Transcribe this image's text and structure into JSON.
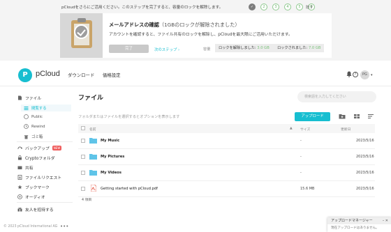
{
  "banner": {
    "message": "pCloudをさらにご活用ください。このステップを完了すると、容量のロックを解除します。",
    "steps": [
      "1",
      "2",
      "3",
      "4",
      "5",
      "6"
    ],
    "skip_label": "隠す",
    "card": {
      "title": "メールアドレスの確認",
      "title_suffix": "（1GBのロックが解除されました）",
      "description": "アカウントを確認すると、ファイル共有のロックを解除し、pCloudを最大限にご活用いただけます。",
      "done_button": "完了",
      "next_step": "次のステップ ›",
      "bonus_label": "容量",
      "unlocked_label": "ロックを解除しました:",
      "unlocked_value": "3.0 GB",
      "total_label": "ロックされました:",
      "total_value": "7.0 GB"
    }
  },
  "header": {
    "logo_text": "pCloud",
    "logo_letter": "P",
    "nav_download": "ダウンロード",
    "nav_pricing": "価格設定",
    "help_glyph": "?",
    "avatar_initials": "PG",
    "caret": "▾"
  },
  "sidebar": {
    "files": "ファイル",
    "sub_items": [
      "閲覧する",
      "Public",
      "Rewind",
      "ゴミ箱"
    ],
    "items": [
      {
        "label": "バックアップ",
        "badge": "NEW"
      },
      {
        "label": "Cryptoフォルダ"
      },
      {
        "label": "共有"
      },
      {
        "label": "ファイルリクエスト"
      },
      {
        "label": "ブックマーク"
      },
      {
        "label": "オーディオ"
      }
    ],
    "invite": "友人を招待する",
    "copyright": "© 2023 pCloud International AG",
    "more": "•••"
  },
  "main": {
    "title": "ファイル",
    "search_placeholder": "検索語を入力してください",
    "hint": "フォルダまたはファイルを選択するとオプションを表示します",
    "upload_button": "アップロード",
    "columns": {
      "name": "名前",
      "name_sort": "▲",
      "size": "サイズ",
      "modified": "更新日"
    },
    "rows": [
      {
        "name": "My Music",
        "size": "-",
        "date": "2023/5/16"
      },
      {
        "name": "My Pictures",
        "size": "-",
        "date": "2023/5/16"
      },
      {
        "name": "My Videos",
        "size": "-",
        "date": "2023/5/16"
      },
      {
        "name": "Getting started with pCloud.pdf",
        "size": "15.6 MB",
        "date": "2023/5/16"
      }
    ],
    "count": "4 項目"
  },
  "upload_manager": {
    "title": "アップロードマネージャー",
    "controls": "– ✕",
    "body": "現在アップロードはありません。"
  },
  "colors": {
    "accent": "#17bed0",
    "folder": "#5fc4e8",
    "pdf": "#e2412c",
    "step_green": "#6bb56b",
    "new_badge": "#ef5a5a"
  },
  "icons": [
    "file-icon",
    "browse-icon",
    "public-icon",
    "rewind-icon",
    "trash-icon",
    "backup-icon",
    "crypto-icon",
    "share-icon",
    "file-request-icon",
    "bookmark-icon",
    "audio-icon",
    "invite-icon",
    "bell-icon",
    "help-icon",
    "new-folder-icon",
    "grid-view-icon",
    "sort-icon",
    "folder-icon",
    "pdf-icon"
  ]
}
